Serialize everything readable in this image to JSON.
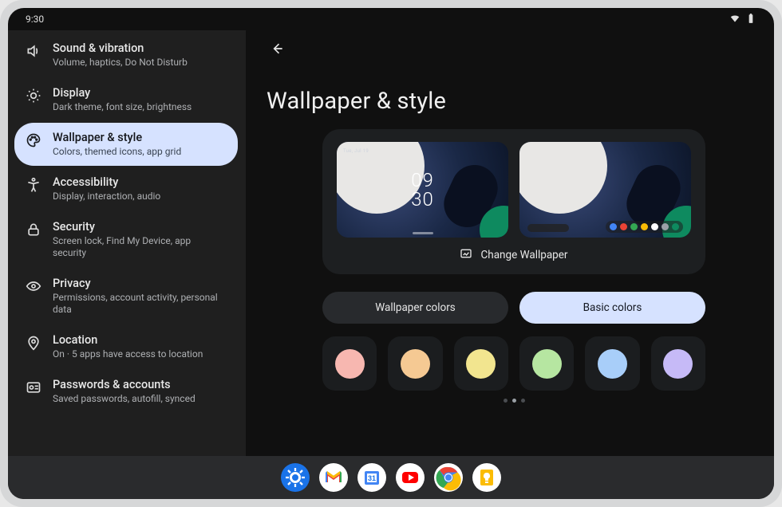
{
  "status": {
    "time": "9:30"
  },
  "sidebar": {
    "items": [
      {
        "id": "sound",
        "label": "Sound & vibration",
        "sub": "Volume, haptics, Do Not Disturb"
      },
      {
        "id": "display",
        "label": "Display",
        "sub": "Dark theme, font size, brightness"
      },
      {
        "id": "wallpaper",
        "label": "Wallpaper & style",
        "sub": "Colors, themed icons, app grid",
        "selected": true
      },
      {
        "id": "accessibility",
        "label": "Accessibility",
        "sub": "Display, interaction, audio"
      },
      {
        "id": "security",
        "label": "Security",
        "sub": "Screen lock, Find My Device, app security"
      },
      {
        "id": "privacy",
        "label": "Privacy",
        "sub": "Permissions, account activity, personal data"
      },
      {
        "id": "location",
        "label": "Location",
        "sub": "On · 5 apps have access to location"
      },
      {
        "id": "passwords",
        "label": "Passwords & accounts",
        "sub": "Saved passwords, autofill, synced"
      }
    ]
  },
  "main": {
    "title": "Wallpaper & style",
    "change_wallpaper": "Change Wallpaper",
    "clock": {
      "date": "Tue, Jul 19",
      "hours": "09",
      "minutes": "30"
    },
    "tabs": {
      "wallpaper_colors": "Wallpaper colors",
      "basic_colors": "Basic colors",
      "active": "basic_colors"
    },
    "swatches": [
      {
        "name": "pink",
        "hex": "#f7b7b0"
      },
      {
        "name": "orange",
        "hex": "#f5c993"
      },
      {
        "name": "yellow",
        "hex": "#f2e58f"
      },
      {
        "name": "green",
        "hex": "#b6e6a1"
      },
      {
        "name": "blue",
        "hex": "#a8cef9"
      },
      {
        "name": "purple",
        "hex": "#c6baf7"
      }
    ],
    "pager": {
      "count": 3,
      "active_index": 1
    }
  },
  "taskbar": {
    "apps": [
      "settings",
      "gmail",
      "calendar",
      "youtube",
      "chrome",
      "keep"
    ]
  }
}
